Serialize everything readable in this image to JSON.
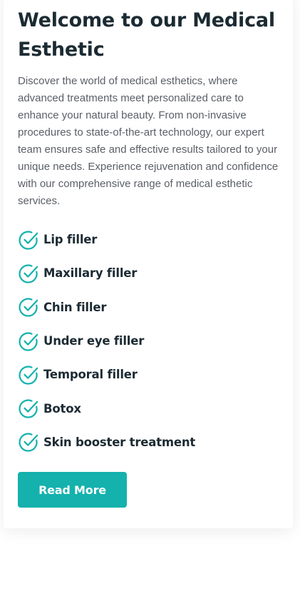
{
  "section": {
    "title": "Welcome to our Medical Esthetic",
    "intro": "Discover the world of medical esthetics, where advanced treatments meet personalized care to enhance your natural beauty. From non-invasive procedures to state-of-the-art technology, our expert team ensures safe and effective results tailored to your unique needs. Experience rejuvenation and confidence with our comprehensive range of medical esthetic services.",
    "features": [
      {
        "label": "Lip filler",
        "icon": "check-circle-icon"
      },
      {
        "label": "Maxillary filler",
        "icon": "check-circle-icon"
      },
      {
        "label": "Chin filler",
        "icon": "check-circle-icon"
      },
      {
        "label": "Under eye filler",
        "icon": "check-circle-icon"
      },
      {
        "label": "Temporal filler",
        "icon": "check-circle-icon"
      },
      {
        "label": "Botox",
        "icon": "check-circle-icon"
      },
      {
        "label": "Skin booster treatment",
        "icon": "check-circle-icon"
      }
    ],
    "button_label": "Read More"
  },
  "colors": {
    "accent": "#14b1ad",
    "heading": "#1c2b33",
    "body_text": "#5a5f66",
    "background": "#ffffff"
  }
}
